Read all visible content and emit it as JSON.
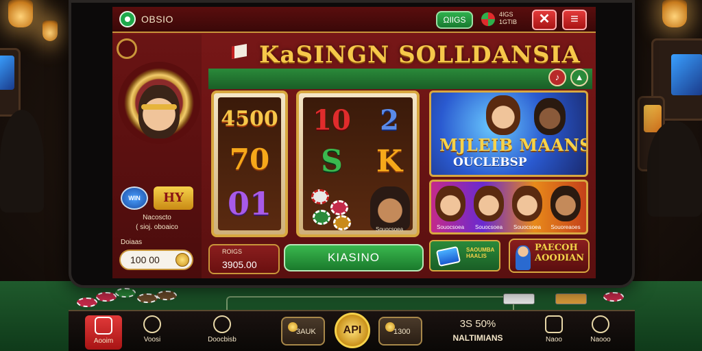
{
  "header": {
    "logo_text": "OBSIO",
    "pill_label": "ΩIIGS",
    "status_line1": "4IGS",
    "status_line2": "1GTIB"
  },
  "left_panel": {
    "badge_a": "WIN",
    "badge_b": "HY",
    "caption1": "Nacoscto",
    "caption2": "( sioj. oboaico",
    "input_label": "Doiaas",
    "input_value": "100 00"
  },
  "title": "KaSINGN SOLLDANSIA",
  "slots": {
    "slot1": [
      "4500",
      "70",
      "01"
    ],
    "slot2": [
      "10",
      "S"
    ],
    "slot3": [
      "2",
      "K"
    ],
    "slot3_caption": "Souocsoea"
  },
  "promo1": {
    "title": "MJLEIB MAANS",
    "subtitle": "OUCLEBSP"
  },
  "promo2": {
    "labels": [
      "Souocsoea",
      "Souocsoea",
      "Souocsoea",
      "Souoreaoes"
    ]
  },
  "price": {
    "label": "ROIGS",
    "value": "3905.00"
  },
  "main_button": "KIASINO",
  "promo_mini": {
    "line1": "SAOUMBA",
    "line2": "HAALIS"
  },
  "promo_badge": {
    "line1": "PAECOH",
    "line2": "AOODIAN"
  },
  "bottom_nav": {
    "home": "Aooim",
    "user": "Voosi",
    "dashboard": "Doocbisb",
    "btn1": "3AUK",
    "api": "API",
    "btn2": "1300",
    "stat_big": "3S 50%",
    "stat_small": "NALTIMIANS",
    "news": "Naoo",
    "clock": "Naooo"
  },
  "colors": {
    "primary_red": "#a81414",
    "accent_gold": "#d8a840",
    "action_green": "#1a7a2c",
    "title_yellow": "#f6c84a"
  }
}
